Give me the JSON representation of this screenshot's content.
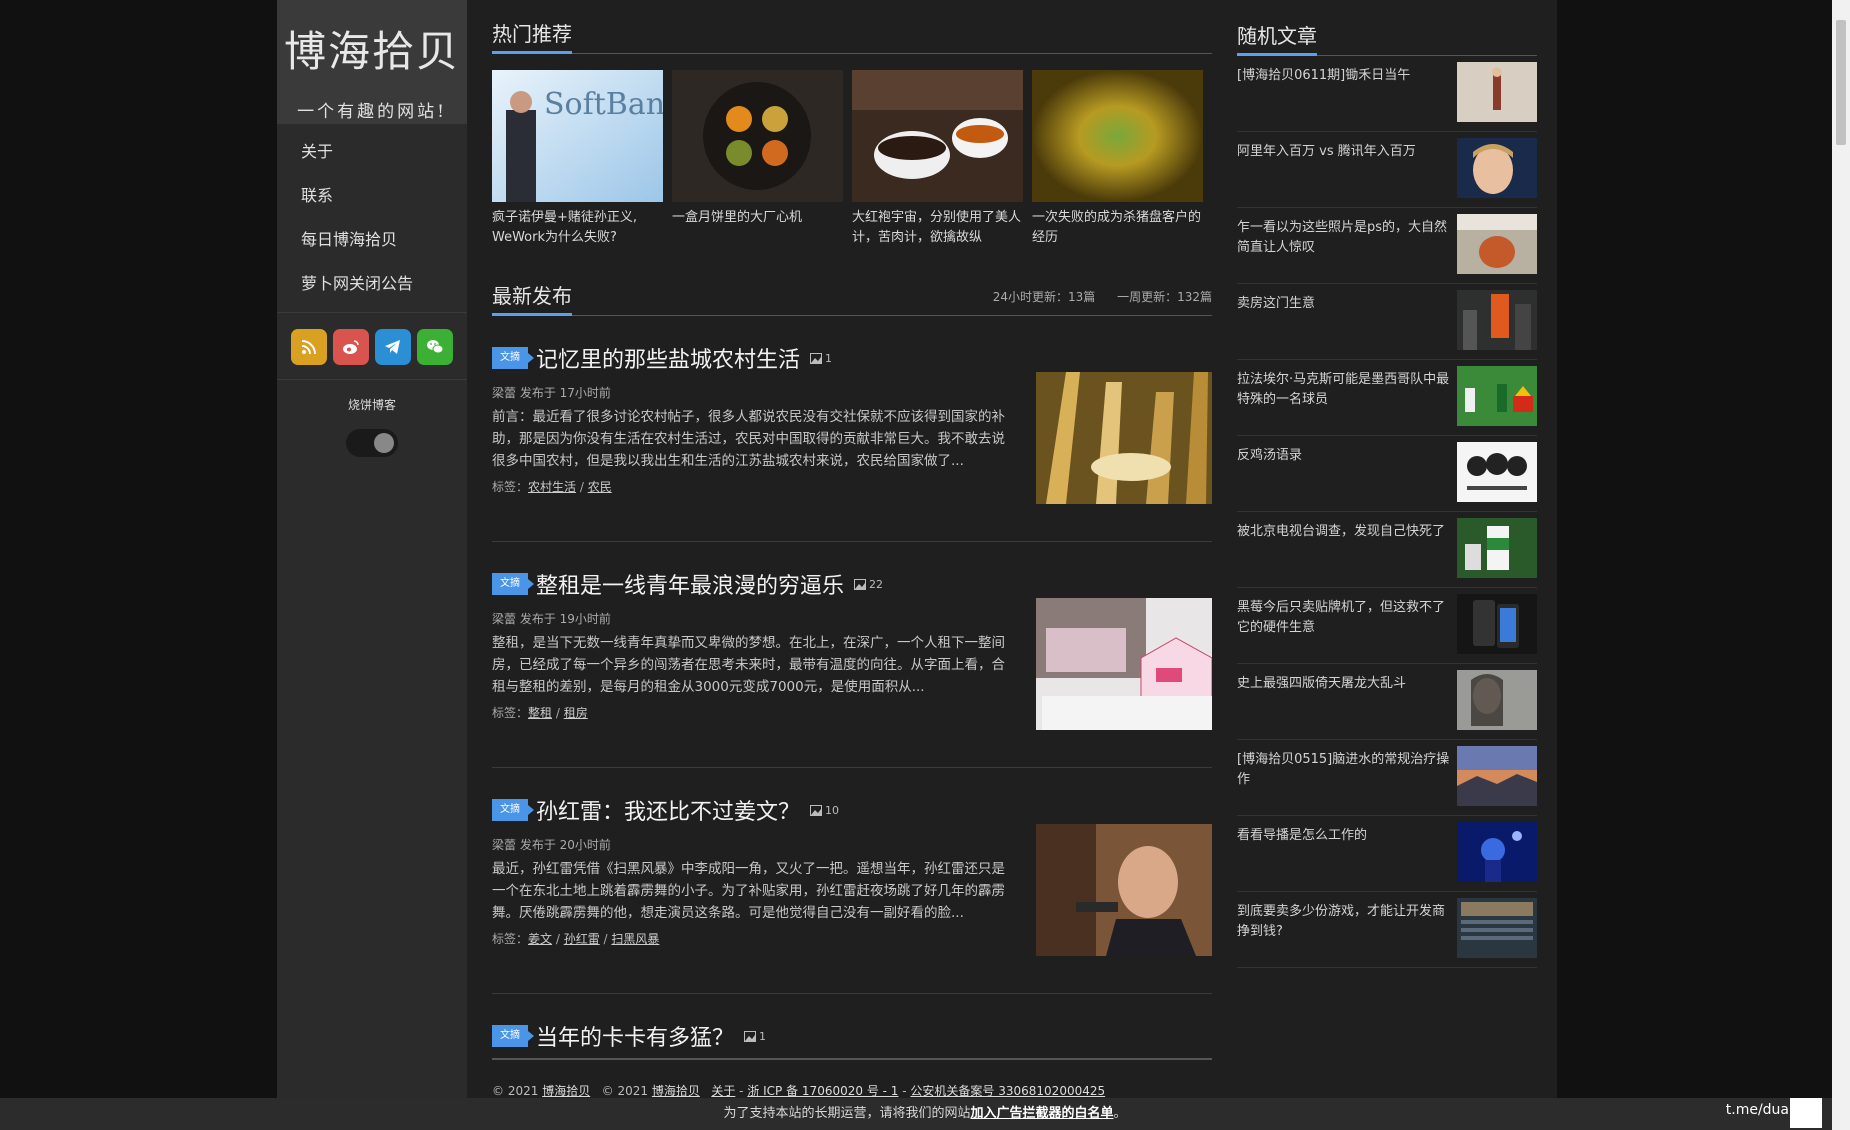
{
  "site": {
    "title": "博海拾贝",
    "tagline": "一个有趣的网站!"
  },
  "nav": [
    "关于",
    "联系",
    "每日博海拾贝",
    "萝卜网关闭公告"
  ],
  "theme": {
    "label": "烧饼博客"
  },
  "hot": {
    "title": "热门推荐",
    "items": [
      {
        "caption": "疯子诺伊曼+赌徒孙正义, WeWork为什么失败?",
        "image_text": "SoftBank"
      },
      {
        "caption": "一盒月饼里的大厂心机"
      },
      {
        "caption": "大红袍宇宙，分别使用了美人计，苦肉计，欲擒故纵"
      },
      {
        "caption": "一次失败的成为杀猪盘客户的经历"
      }
    ]
  },
  "latest": {
    "title": "最新发布",
    "stat_24h": "24小时更新：13篇",
    "stat_week": "一周更新：132篇",
    "badge": "文摘",
    "tag_label": "标签：",
    "posts": [
      {
        "title": "记忆里的那些盐城农村生活",
        "img_count": "1",
        "meta": "梁蕾 发布于 17小时前",
        "excerpt": "前言：最近看了很多讨论农村帖子，很多人都说农民没有交社保就不应该得到国家的补助，那是因为你没有生活在农村生活过，农民对中国取得的贡献非常巨大。我不敢去说很多中国农村，但是我以我出生和生活的江苏盐城农村来说，农民给国家做了...",
        "tags": [
          "农村生活",
          "农民"
        ]
      },
      {
        "title": "整租是一线青年最浪漫的穷逼乐",
        "img_count": "22",
        "meta": "梁蕾 发布于 19小时前",
        "excerpt": "整租，是当下无数一线青年真挚而又卑微的梦想。在北上，在深广，一个人租下一整间房，已经成了每一个异乡的闯荡者在思考未来时，最带有温度的向往。从字面上看，合租与整租的差别，是每月的租金从3000元变成7000元，是使用面积从...",
        "tags": [
          "整租",
          "租房"
        ]
      },
      {
        "title": "孙红雷：我还比不过姜文？",
        "img_count": "10",
        "meta": "梁蕾 发布于 20小时前",
        "excerpt": "最近，孙红雷凭借《扫黑风暴》中李成阳一角，又火了一把。遥想当年，孙红雷还只是一个在东北土地上跳着霹雳舞的小子。为了补贴家用，孙红雷赶夜场跳了好几年的霹雳舞。厌倦跳霹雳舞的他，想走演员这条路。可是他觉得自己没有一副好看的脸...",
        "tags": [
          "姜文",
          "孙红雷",
          "扫黑风暴"
        ]
      },
      {
        "title": "当年的卡卡有多猛？",
        "img_count": "1"
      }
    ]
  },
  "random": {
    "title": "随机文章",
    "items": [
      "[博海拾贝0611期]锄禾日当午",
      "阿里年入百万 vs 腾讯年入百万",
      "乍一看以为这些照片是ps的，大自然简直让人惊叹",
      "卖房这门生意",
      "拉法埃尔·马克斯可能是墨西哥队中最特殊的一名球员",
      "反鸡汤语录",
      "被北京电视台调查，发现自己快死了",
      "黑莓今后只卖贴牌机了，但这救不了它的硬件生意",
      "史上最强四版倚天屠龙大乱斗",
      "[博海拾贝0515]脑进水的常规治疗操作",
      "看看导播是怎么工作的",
      "到底要卖多少份游戏，才能让开发商挣到钱?"
    ]
  },
  "footer": {
    "copy1": "© 2021",
    "site1": "博海拾贝",
    "copy2": "© 2021",
    "site2": "博海拾贝",
    "about": "关于",
    "icp": "浙 ICP 备 17060020 号 - 1",
    "sep": "-",
    "police": "公安机关备案号 33068102000425"
  },
  "banner": {
    "text": "为了支持本站的长期运营，请将我们的网站",
    "link": "加入广告拦截器的白名单",
    "end": "。"
  },
  "watermark": "t.me/duanzig",
  "colors": {
    "accent": "#4a95e8",
    "rss": "#d9a021",
    "weibo": "#d9534f",
    "telegram": "#2b8fd6",
    "wechat": "#3cb034"
  }
}
